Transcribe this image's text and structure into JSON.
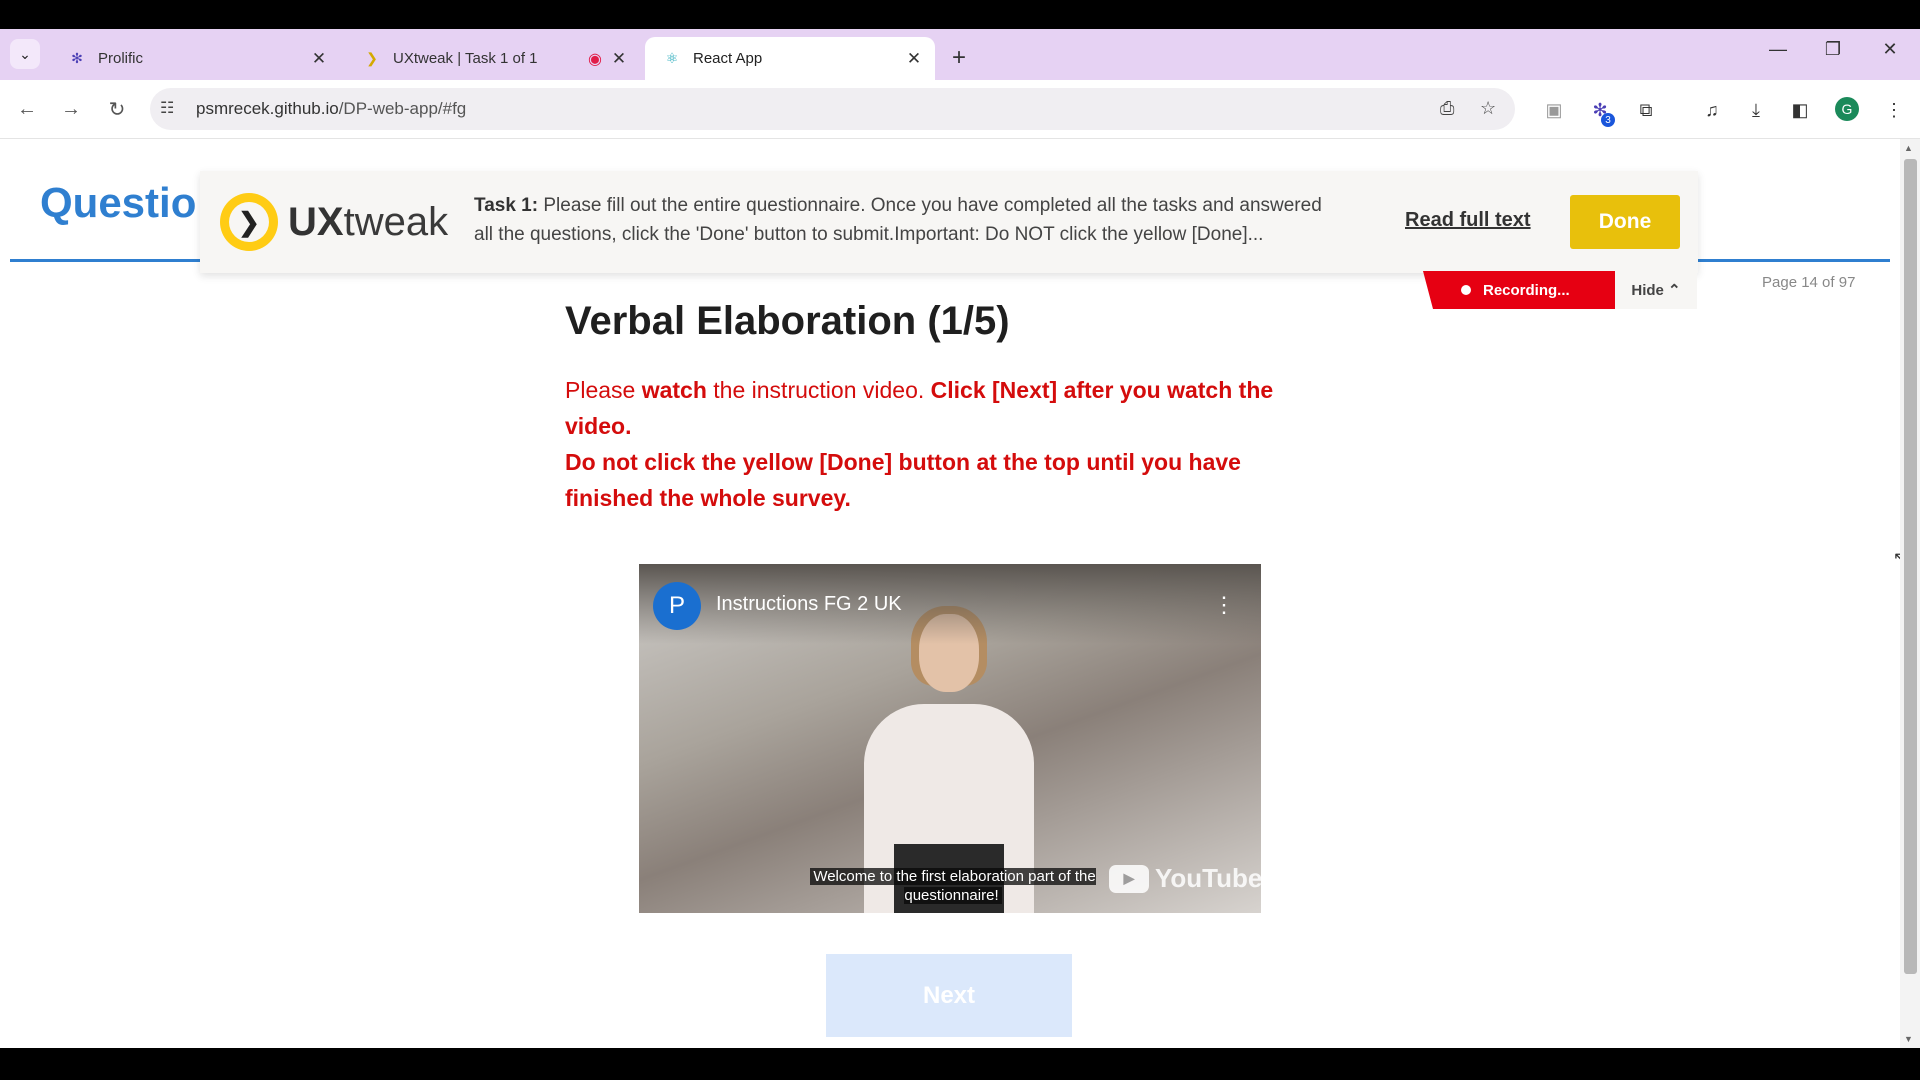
{
  "browser": {
    "tabs": [
      {
        "title": "Prolific",
        "close": "✕"
      },
      {
        "title": "UXtweak | Task 1 of 1",
        "close": "✕"
      },
      {
        "title": "React App",
        "close": "✕"
      }
    ],
    "new_tab": "+",
    "url_host": "psmrecek.github.io",
    "url_path": "/DP-web-app/#fg",
    "avatar_letter": "G",
    "extension_badge": "3",
    "window_controls": {
      "minimize": "—",
      "restore": "❐",
      "close": "✕"
    }
  },
  "page": {
    "header_title": "Questio",
    "page_counter": "Page 14 of 97",
    "heading": "Verbal Elaboration (1/5)",
    "instructions": {
      "p1_a": "Please ",
      "p1_b": "watch",
      "p1_c": " the instruction video. ",
      "p1_d": "Click [Next] after you watch the video.",
      "p2": "Do not click the yellow [Done] button at the top until you have finished the whole survey."
    },
    "next_label": "Next"
  },
  "uxtweak": {
    "brand_bold": "UX",
    "brand_rest": "tweak",
    "task_label": "Task 1:",
    "task_text": " Please fill out the entire questionnaire. Once you have completed all the tasks and answered all the questions, click the 'Done' button to submit.Important: Do NOT click the yellow [Done]...",
    "read_full_text": "Read full text",
    "done_label": "Done",
    "recording_label": "Recording...",
    "hide_label": "Hide"
  },
  "video": {
    "channel_letter": "P",
    "title": "Instructions FG 2 UK",
    "caption": "Welcome to the first elaboration part of the questionnaire!",
    "platform": "YouTube"
  },
  "colors": {
    "tabstrip": "#e6d2f3",
    "accent_blue": "#2f7fd0",
    "instruction_red": "#d40c0c",
    "ux_yellow": "#e8c00c",
    "recording_red": "#e60012",
    "next_disabled": "#dbe8fb"
  }
}
